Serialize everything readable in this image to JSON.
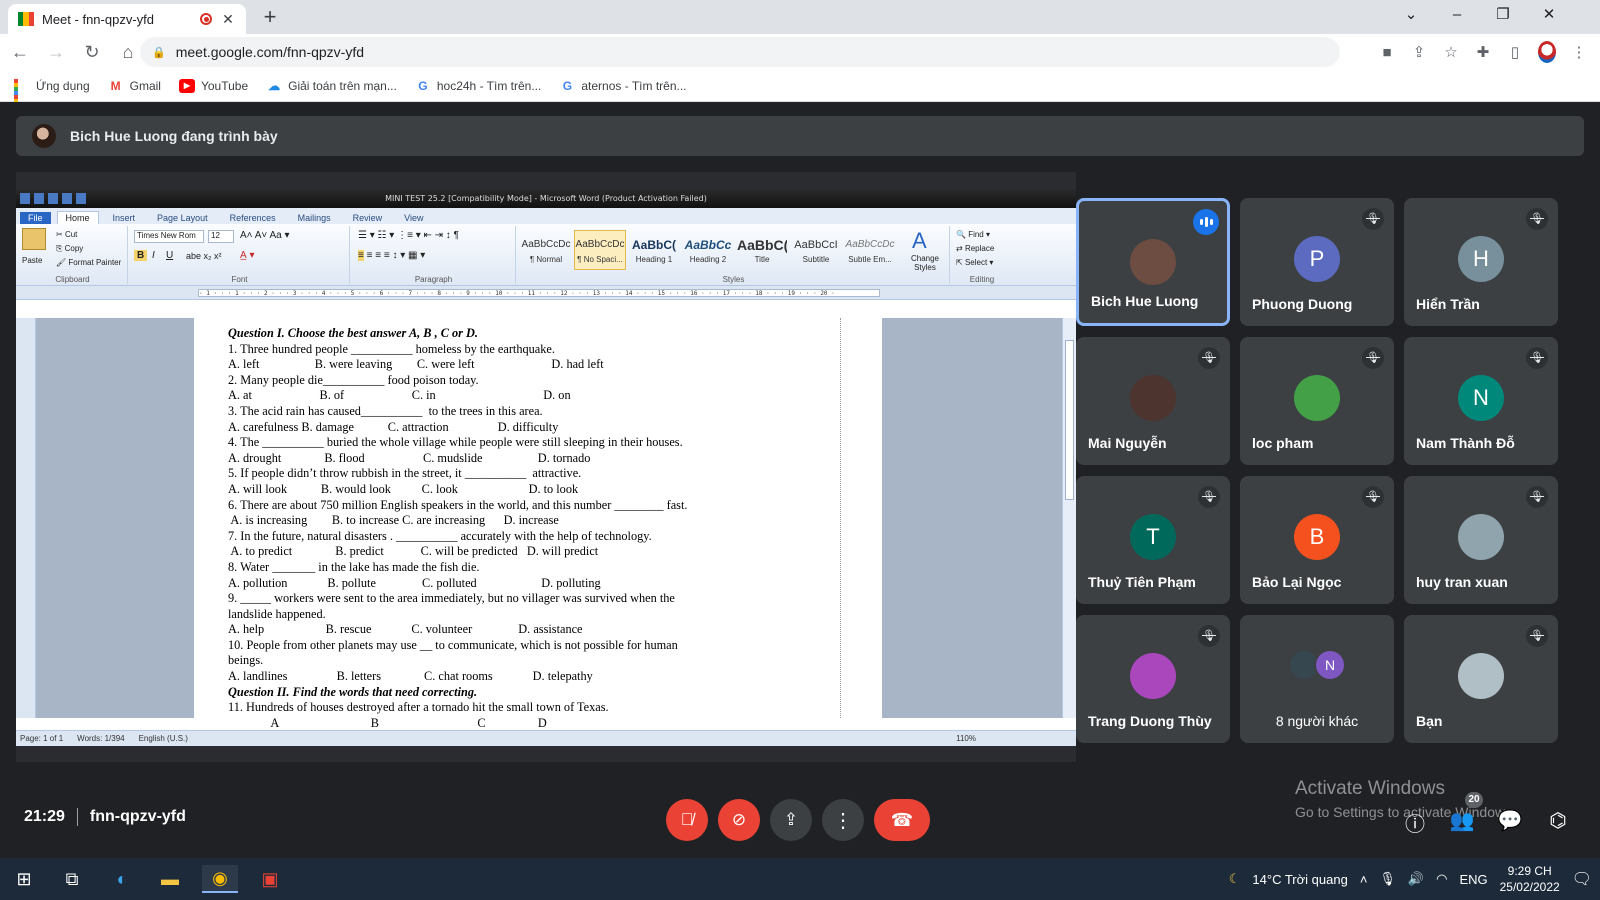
{
  "browser": {
    "tab_title": "Meet - fnn-qpzv-yfd",
    "url": "meet.google.com/fnn-qpzv-yfd",
    "bookmarks": [
      {
        "label": "Ứng dụng",
        "icon": "apps-icon"
      },
      {
        "label": "Gmail",
        "icon": "gmail-icon"
      },
      {
        "label": "YouTube",
        "icon": "youtube-icon"
      },
      {
        "label": "Giải toán trên mạn...",
        "icon": "cloud-icon"
      },
      {
        "label": "hoc24h - Tìm trên...",
        "icon": "google-icon"
      },
      {
        "label": "aternos - Tìm trên...",
        "icon": "google-icon"
      }
    ]
  },
  "meet": {
    "presenting_text": "Bich Hue Luong đang trình bày",
    "time": "21:29",
    "meeting_code": "fnn-qpzv-yfd",
    "participants_count": "20",
    "activate_title": "Activate Windows",
    "activate_sub": "Go to Settings to activate Windows."
  },
  "participants": [
    {
      "name": "Bich Hue Luong",
      "initial": "",
      "color": "#6d4c41",
      "speaking": true
    },
    {
      "name": "Phuong Duong",
      "initial": "P",
      "color": "#5c6bc0",
      "speaking": false
    },
    {
      "name": "Hiển Trần",
      "initial": "H",
      "color": "#78909c",
      "speaking": false
    },
    {
      "name": "Mai Nguyễn",
      "initial": "",
      "color": "#4e342e",
      "speaking": false
    },
    {
      "name": "loc pham",
      "initial": "",
      "color": "#43a047",
      "speaking": false
    },
    {
      "name": "Nam Thành Đỗ",
      "initial": "N",
      "color": "#00897b",
      "speaking": false
    },
    {
      "name": "Thuỷ Tiên Phạm",
      "initial": "T",
      "color": "#00695c",
      "speaking": false
    },
    {
      "name": "Bảo Lại Ngọc",
      "initial": "B",
      "color": "#f4511e",
      "speaking": false
    },
    {
      "name": "huy tran xuan",
      "initial": "",
      "color": "#90a4ae",
      "speaking": false
    },
    {
      "name": "Trang Duong Thùy",
      "initial": "",
      "color": "#ab47bc",
      "speaking": false
    },
    {
      "name": "8 người khác",
      "initial": "N",
      "color": "#7e57c2",
      "speaking": false
    },
    {
      "name": "Bạn",
      "initial": "",
      "color": "#b0bec5",
      "speaking": false
    }
  ],
  "word": {
    "title": "MINI TEST 25.2 [Compatibility Mode] - Microsoft Word (Product Activation Failed)",
    "tabs": [
      "File",
      "Home",
      "Insert",
      "Page Layout",
      "References",
      "Mailings",
      "Review",
      "View"
    ],
    "font_name": "Times New Rom",
    "font_size": "12",
    "clipboard": {
      "paste": "Paste",
      "cut": "Cut",
      "copy": "Copy",
      "format_painter": "Format Painter",
      "group": "Clipboard"
    },
    "groups": {
      "font": "Font",
      "paragraph": "Paragraph",
      "styles": "Styles",
      "editing": "Editing"
    },
    "styles": [
      {
        "sample": "AaBbCcDc",
        "label": "¶ Normal"
      },
      {
        "sample": "AaBbCcDc",
        "label": "¶ No Spaci..."
      },
      {
        "sample": "AaBbC(",
        "label": "Heading 1"
      },
      {
        "sample": "AaBbCc",
        "label": "Heading 2"
      },
      {
        "sample": "AaBbC(",
        "label": "Title"
      },
      {
        "sample": "AaBbCcI",
        "label": "Subtitle"
      },
      {
        "sample": "AaBbCcDc",
        "label": "Subtle Em..."
      }
    ],
    "change_styles": "Change Styles",
    "editing": {
      "find": "Find",
      "replace": "Replace",
      "select": "Select"
    },
    "status": {
      "page": "Page: 1 of 1",
      "words": "Words: 1/394",
      "lang": "English (U.S.)",
      "zoom": "110%"
    },
    "doc_lines": [
      {
        "t": "Question I. Choose the best answer A, B , C or D.",
        "h": true
      },
      {
        "t": "1. Three hundred people __________ homeless by the earthquake."
      },
      {
        "t": "A. left                  B. were leaving        C. were left                         D. had left"
      },
      {
        "t": "2. Many people die__________ food poison today."
      },
      {
        "t": "A. at                      B. of                      C. in                                   D. on"
      },
      {
        "t": "3. The acid rain has caused__________  to the trees in this area."
      },
      {
        "t": "A. carefulness B. damage           C. attraction                D. difficulty"
      },
      {
        "t": "4. The __________ buried the whole village while people were still sleeping in their houses."
      },
      {
        "t": "A. drought              B. flood                   C. mudslide                  D. tornado"
      },
      {
        "t": "5. If people didn’t throw rubbish in the street, it __________  attractive."
      },
      {
        "t": "A. will look           B. would look          C. look                       D. to look"
      },
      {
        "t": "6. There are about 750 million English speakers in the world, and this number ________ fast."
      },
      {
        "t": " A. is increasing        B. to increase C. are increasing      D. increase"
      },
      {
        "t": "7. In the future, natural disasters . __________ accurately with the help of technology."
      },
      {
        "t": " A. to predict              B. predict            C. will be predicted   D. will predict"
      },
      {
        "t": "8. Water _______ in the lake has made the fish die."
      },
      {
        "t": "A. pollution             B. pollute               C. polluted                     D. polluting"
      },
      {
        "t": "9. _____ workers were sent to the area immediately, but no villager was survived when the"
      },
      {
        "t": "landslide happened."
      },
      {
        "t": "A. help                    B. rescue             C. volunteer               D. assistance"
      },
      {
        "t": "10. People from other planets may use __ to communicate, which is not possible for human"
      },
      {
        "t": "beings."
      },
      {
        "t": "A. landlines                B. letters              C. chat rooms             D. telepathy"
      },
      {
        "t": "Question II. Find the words that need correcting.",
        "h": true
      },
      {
        "t": "11. Hundreds of houses destroyed after a tornado hit the small town of Texas."
      },
      {
        "t": "              A                              B                                C                 D"
      }
    ]
  },
  "taskbar": {
    "weather": "14°C  Trời quang",
    "lang": "ENG",
    "time": "9:29 CH",
    "date": "25/02/2022"
  }
}
